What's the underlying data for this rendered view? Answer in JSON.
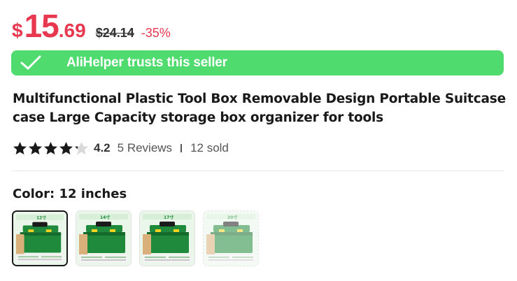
{
  "price": {
    "currency": "$",
    "integer": "15",
    "decimal": ".69",
    "original": "$24.14",
    "discount": "-35%"
  },
  "trust_banner": {
    "text": "AliHelper trusts this seller"
  },
  "product": {
    "title": "Multifunctional Plastic Tool Box Removable Design Portable Suitcase case Large Capacity storage box organizer for tools"
  },
  "rating": {
    "value": "4.2",
    "stars": 4.2,
    "reviews": "5 Reviews",
    "sold": "12 sold"
  },
  "color": {
    "label": "Color: 12 inches"
  },
  "options": [
    {
      "size_label": "12寸",
      "selected": true,
      "available": true
    },
    {
      "size_label": "14寸",
      "selected": false,
      "available": true
    },
    {
      "size_label": "17寸",
      "selected": false,
      "available": true
    },
    {
      "size_label": "20寸",
      "selected": false,
      "available": false
    }
  ],
  "colors": {
    "price": "#e8384f",
    "trust_green": "#4fdb6e",
    "box_green": "#1f8a3c",
    "box_yellow": "#f4d21e"
  }
}
